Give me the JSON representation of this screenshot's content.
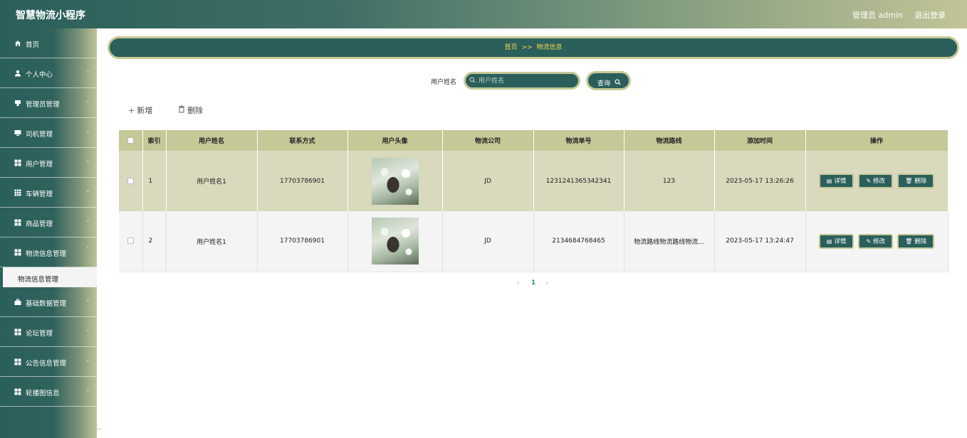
{
  "header": {
    "title": "智慧物流小程序",
    "admin_label": "管理员 admin",
    "logout_label": "退出登录"
  },
  "sidebar": {
    "items": [
      {
        "label": "首页",
        "icon": "home-icon",
        "has_children": false
      },
      {
        "label": "个人中心",
        "icon": "user-icon",
        "has_children": true
      },
      {
        "label": "管理员管理",
        "icon": "admin-icon",
        "has_children": true
      },
      {
        "label": "司机管理",
        "icon": "monitor-icon",
        "has_children": true
      },
      {
        "label": "用户管理",
        "icon": "grid-icon",
        "has_children": true
      },
      {
        "label": "车辆管理",
        "icon": "grid-icon",
        "has_children": true
      },
      {
        "label": "商品管理",
        "icon": "grid-icon",
        "has_children": true
      },
      {
        "label": "物流信息管理",
        "icon": "grid-icon",
        "has_children": true
      },
      {
        "label": "基础数据管理",
        "icon": "briefcase-icon",
        "has_children": true
      },
      {
        "label": "论坛管理",
        "icon": "grid-icon",
        "has_children": true
      },
      {
        "label": "公告信息管理",
        "icon": "grid-icon",
        "has_children": true
      },
      {
        "label": "轮播图信息",
        "icon": "grid-icon",
        "has_children": true
      }
    ],
    "active_submenu": "物流信息管理",
    "corner_text": "..."
  },
  "breadcrumb": {
    "home": "首页",
    "separator": ">>",
    "current": "物流信息"
  },
  "search": {
    "label": "用户姓名",
    "placeholder": "用户姓名",
    "value": "",
    "button_label": "查询"
  },
  "toolbar": {
    "add_label": "新增",
    "delete_label": "删除"
  },
  "table": {
    "columns": [
      "索引",
      "用户姓名",
      "联系方式",
      "用户头像",
      "物流公司",
      "物流单号",
      "物流路线",
      "添加时间",
      "操作"
    ],
    "rows": [
      {
        "index": "1",
        "name": "用户姓名1",
        "phone": "17703786901",
        "company": "JD",
        "tracking_no": "1231241365342341",
        "route": "123",
        "created": "2023-05-17 13:26:26"
      },
      {
        "index": "2",
        "name": "用户姓名1",
        "phone": "17703786901",
        "company": "JD",
        "tracking_no": "2134684768465",
        "route": "物流路线物流路线物流...",
        "created": "2023-05-17 13:24:47"
      }
    ],
    "actions": {
      "detail": "详情",
      "edit": "修改",
      "delete": "删除"
    }
  },
  "pagination": {
    "prev": "‹",
    "current_page": "1",
    "next": "›"
  },
  "colors": {
    "primary": "#2b5f5b",
    "accent": "#c5c897",
    "breadcrumb_text": "#f1d84b",
    "row_highlight": "#d8d9bd"
  }
}
